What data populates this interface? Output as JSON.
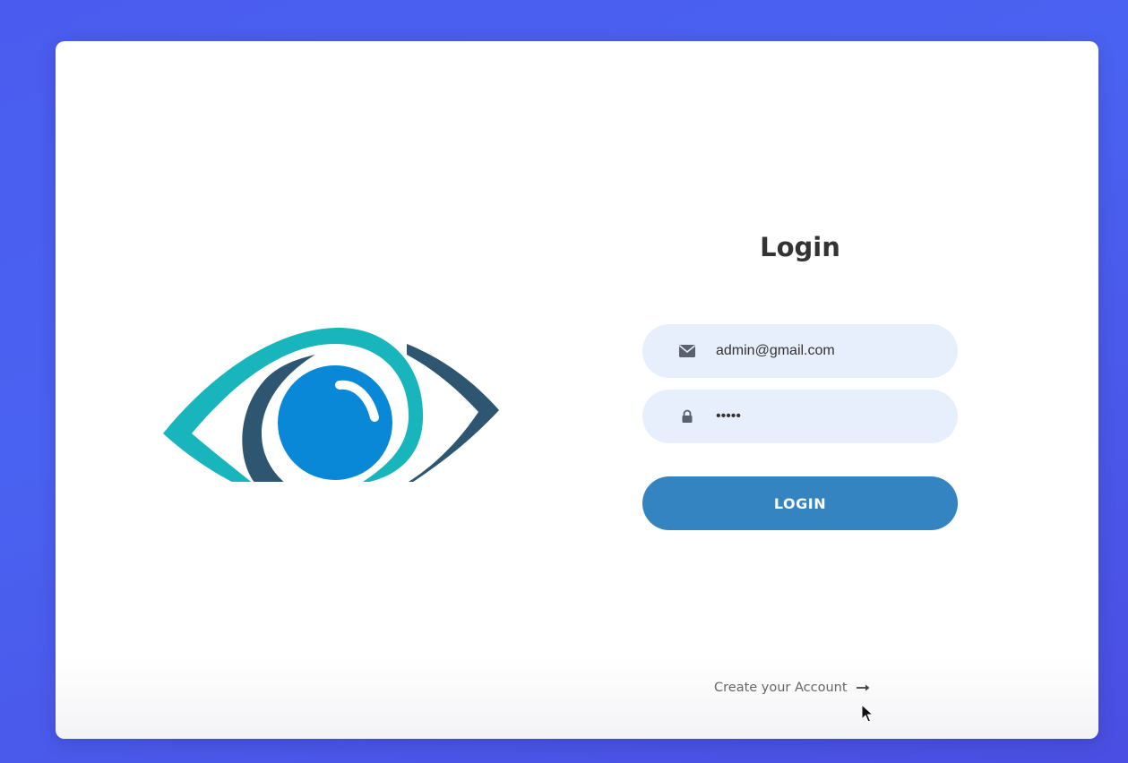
{
  "form": {
    "title": "Login",
    "email_value": "admin@gmail.com",
    "password_value": "•••••",
    "login_label": "LOGIN",
    "create_account_label": "Create your Account"
  },
  "icons": {
    "logo": "eye-logo",
    "email": "envelope-icon",
    "password": "lock-icon",
    "link_arrow": "arrow-right-icon",
    "cursor": "mouse-cursor"
  },
  "colors": {
    "background": "#4a5cef",
    "card": "#ffffff",
    "field": "#e7eefc",
    "button": "#3584c2",
    "eye_teal": "#18b5bd",
    "eye_dark": "#2e5670",
    "eye_iris": "#0888d6"
  }
}
